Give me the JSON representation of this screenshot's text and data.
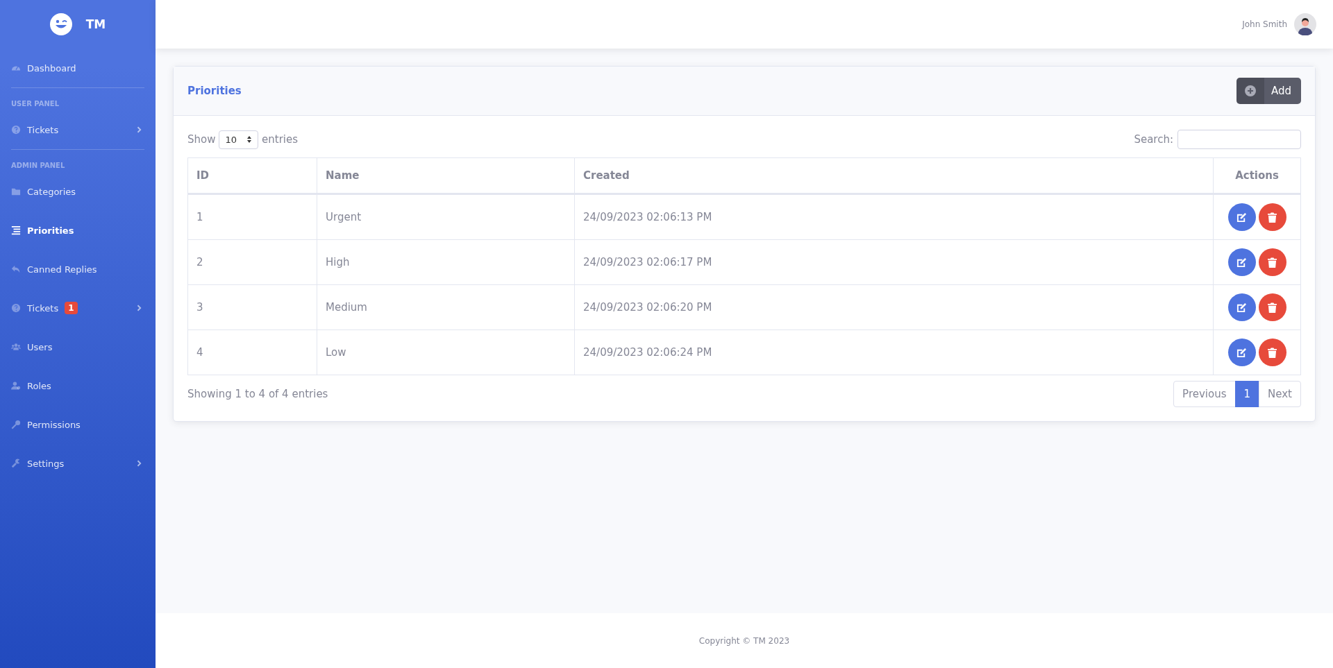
{
  "sidebar": {
    "brand": "TM",
    "sections": [
      {
        "items": [
          {
            "label": "Dashboard",
            "selected": false,
            "expandable": false
          }
        ]
      },
      {
        "heading": "USER PANEL",
        "items": [
          {
            "label": "Tickets",
            "selected": false,
            "expandable": true
          }
        ]
      },
      {
        "heading": "ADMIN PANEL",
        "items": [
          {
            "label": "Categories",
            "selected": false,
            "expandable": false
          },
          {
            "label": "Priorities",
            "selected": true,
            "expandable": false
          },
          {
            "label": "Canned Replies",
            "selected": false,
            "expandable": false
          },
          {
            "label": "Tickets",
            "selected": false,
            "expandable": true,
            "badge": "1"
          },
          {
            "label": "Users",
            "selected": false,
            "expandable": false
          },
          {
            "label": "Roles",
            "selected": false,
            "expandable": false
          },
          {
            "label": "Permissions",
            "selected": false,
            "expandable": false
          },
          {
            "label": "Settings",
            "selected": false,
            "expandable": true
          }
        ]
      }
    ]
  },
  "topbar": {
    "user_name": "John Smith"
  },
  "card": {
    "title": "Priorities",
    "add_button": "Add",
    "length": {
      "before": "Show",
      "value": "10",
      "after": "entries"
    },
    "search": {
      "label": "Search:"
    },
    "table": {
      "columns": [
        "ID",
        "Name",
        "Created",
        "Actions"
      ],
      "rows": [
        [
          "1",
          "Urgent",
          "24/09/2023 02:06:13 PM"
        ],
        [
          "2",
          "High",
          "24/09/2023 02:06:17 PM"
        ],
        [
          "3",
          "Medium",
          "24/09/2023 02:06:20 PM"
        ],
        [
          "4",
          "Low",
          "24/09/2023 02:06:24 PM"
        ]
      ]
    },
    "info": "Showing 1 to 4 of 4 entries",
    "pagination": [
      {
        "label": "Previous",
        "selected": false
      },
      {
        "label": "1",
        "selected": true
      },
      {
        "label": "Next",
        "selected": false
      }
    ]
  },
  "footer": "Copyright © TM 2023"
}
